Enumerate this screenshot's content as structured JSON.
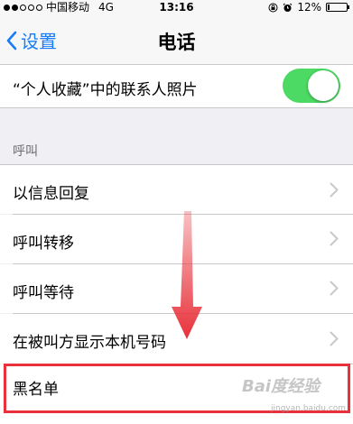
{
  "status_bar": {
    "signal_dots": [
      true,
      true,
      false,
      false,
      false
    ],
    "carrier": "中国移动",
    "network": "4G",
    "time": "13:16",
    "battery_percent": "12%",
    "battery_level": 0.12
  },
  "nav": {
    "back_label": "设置",
    "title": "电话"
  },
  "contacts_photo_row": {
    "label": "“个人收藏”中的联系人照片",
    "toggle_on": true
  },
  "call_section": {
    "header": "呼叫",
    "items": [
      {
        "label": "以信息回复"
      },
      {
        "label": "呼叫转移"
      },
      {
        "label": "呼叫等待"
      },
      {
        "label": "在被叫方显示本机号码"
      },
      {
        "label": "黑名单"
      }
    ]
  },
  "watermark": {
    "text": "Bai度经验",
    "url": "jingyan.baidu.com"
  },
  "colors": {
    "accent": "#1a7cf5",
    "toggle_on": "#4cd964",
    "annotation_red": "#e8313a"
  }
}
